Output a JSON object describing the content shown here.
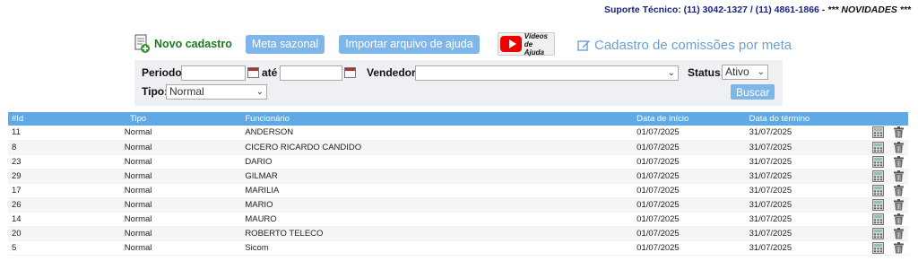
{
  "support": {
    "label": "Suporte Técnico: (11) 3042-1327 / (11) 4861-1866",
    "separator": " - ",
    "news": "*** NOVIDADES ***"
  },
  "toolbar": {
    "novo_cadastro": "Novo cadastro",
    "meta_sazonal": "Meta sazonal",
    "importar": "Importar arquivo de ajuda",
    "videos_line1": "Vídeos",
    "videos_line2": "de Ajuda",
    "comissoes": "Cadastro de comissões por meta"
  },
  "filter": {
    "periodo_label": "Periodo:",
    "periodo_start": "",
    "ate_label": "até",
    "periodo_end": "",
    "vendedor_label": "Vendedor:",
    "vendedor_value": "",
    "status_label": "Status:",
    "status_value": "Ativo",
    "tipo_label": "Tipo:",
    "tipo_value": "Normal",
    "buscar": "Buscar"
  },
  "table": {
    "headers": [
      "#Id",
      "Tipo",
      "Funcionário",
      "Data de início",
      "Data do término"
    ],
    "rows": [
      {
        "id": "11",
        "tipo": "Normal",
        "funcionario": "ANDERSON",
        "inicio": "01/07/2025",
        "termino": "31/07/2025"
      },
      {
        "id": "8",
        "tipo": "Normal",
        "funcionario": "CICERO RICARDO CANDIDO",
        "inicio": "01/07/2025",
        "termino": "31/07/2025"
      },
      {
        "id": "23",
        "tipo": "Normal",
        "funcionario": "DARIO",
        "inicio": "01/07/2025",
        "termino": "31/07/2025"
      },
      {
        "id": "29",
        "tipo": "Normal",
        "funcionario": "GILMAR",
        "inicio": "01/07/2025",
        "termino": "31/07/2025"
      },
      {
        "id": "17",
        "tipo": "Normal",
        "funcionario": "MARILIA",
        "inicio": "01/07/2025",
        "termino": "31/07/2025"
      },
      {
        "id": "26",
        "tipo": "Normal",
        "funcionario": "MARIO",
        "inicio": "01/07/2025",
        "termino": "31/07/2025"
      },
      {
        "id": "14",
        "tipo": "Normal",
        "funcionario": "MAURO",
        "inicio": "01/07/2025",
        "termino": "31/07/2025"
      },
      {
        "id": "20",
        "tipo": "Normal",
        "funcionario": "ROBERTO TELECO",
        "inicio": "01/07/2025",
        "termino": "31/07/2025"
      },
      {
        "id": "5",
        "tipo": "Normal",
        "funcionario": "Sicom",
        "inicio": "01/07/2025",
        "termino": "31/07/2025"
      }
    ]
  },
  "colors": {
    "header_blue": "#5ea9e6",
    "button_blue": "#7eb6ea",
    "support_navy": "#1a237e",
    "novo_green": "#1b7a1b",
    "link_blue": "#6c9fd2"
  },
  "icons": {
    "novo": "document-add-icon",
    "videos": "youtube-icon",
    "comissoes": "edit-icon",
    "row_edit": "calculator-icon",
    "row_delete": "trash-icon",
    "calendar": "calendar-icon"
  }
}
